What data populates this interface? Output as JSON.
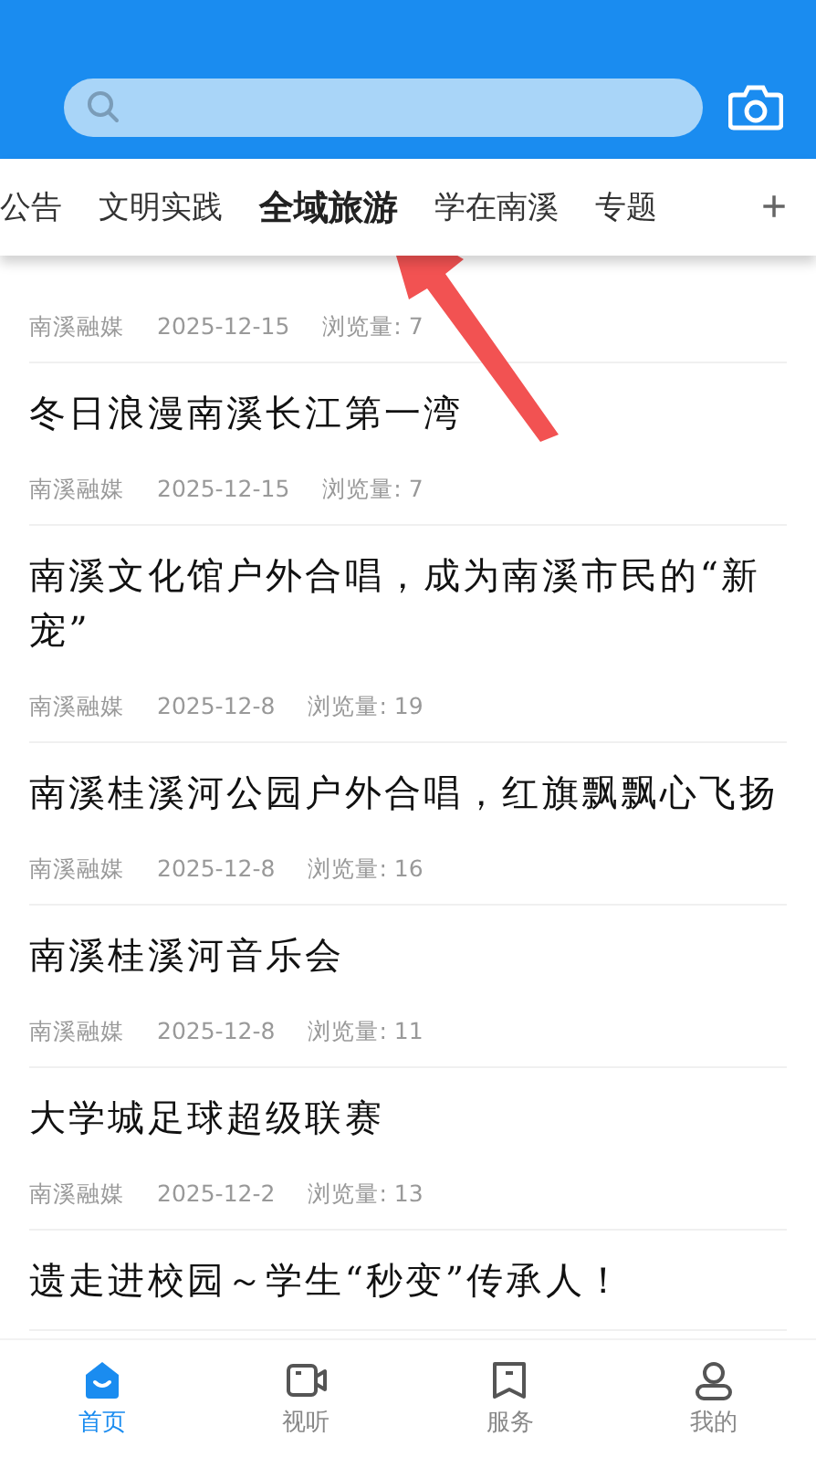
{
  "tabs": [
    {
      "label": "公告",
      "selected": false
    },
    {
      "label": "文明实践",
      "selected": false
    },
    {
      "label": "全域旅游",
      "selected": true
    },
    {
      "label": "学在南溪",
      "selected": false
    },
    {
      "label": "专题",
      "selected": false
    }
  ],
  "add_tab": "+",
  "articles": [
    {
      "source": "南溪融媒",
      "date": "2025-12-15",
      "views": "浏览量: 7"
    },
    {
      "title": "冬日浪漫南溪长江第一湾",
      "source": "南溪融媒",
      "date": "2025-12-15",
      "views": "浏览量: 7"
    },
    {
      "title": "南溪文化馆户外合唱，成为南溪市民的“新宠”",
      "source": "南溪融媒",
      "date": "2025-12-8",
      "views": "浏览量: 19"
    },
    {
      "title": "南溪桂溪河公园户外合唱，红旗飘飘心飞扬",
      "source": "南溪融媒",
      "date": "2025-12-8",
      "views": "浏览量: 16"
    },
    {
      "title": "南溪桂溪河音乐会",
      "source": "南溪融媒",
      "date": "2025-12-8",
      "views": "浏览量: 11"
    },
    {
      "title": "大学城足球超级联赛",
      "source": "南溪融媒",
      "date": "2025-12-2",
      "views": "浏览量: 13"
    },
    {
      "title": "遗走进校园～学生“秒变”传承人！"
    }
  ],
  "nav": [
    {
      "kind": "home",
      "label": "首页",
      "selected": true
    },
    {
      "kind": "video",
      "label": "视听",
      "selected": false
    },
    {
      "kind": "service",
      "label": "服务",
      "selected": false
    },
    {
      "kind": "profile",
      "label": "我的",
      "selected": false
    }
  ]
}
